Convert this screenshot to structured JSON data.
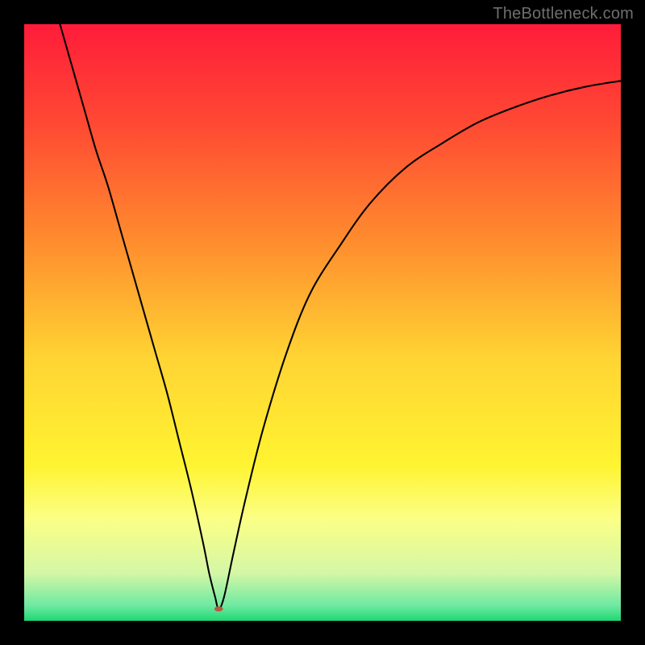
{
  "watermark": {
    "text": "TheBottleneck.com"
  },
  "chart_data": {
    "type": "line",
    "title": "",
    "xlabel": "",
    "ylabel": "",
    "xlim": [
      0,
      100
    ],
    "ylim": [
      0,
      100
    ],
    "grid": false,
    "legend": false,
    "background_gradient_stops": [
      {
        "pos": 0.0,
        "color": "#ff1c3a"
      },
      {
        "pos": 0.17,
        "color": "#ff4a33"
      },
      {
        "pos": 0.36,
        "color": "#ff8b2e"
      },
      {
        "pos": 0.56,
        "color": "#ffd433"
      },
      {
        "pos": 0.74,
        "color": "#fff432"
      },
      {
        "pos": 0.83,
        "color": "#fbff86"
      },
      {
        "pos": 0.92,
        "color": "#d4f7a6"
      },
      {
        "pos": 0.975,
        "color": "#6de9a1"
      },
      {
        "pos": 1.0,
        "color": "#1fd673"
      }
    ],
    "series": [
      {
        "name": "bottleneck-curve",
        "x": [
          6,
          8,
          10,
          12,
          14,
          16,
          18,
          20,
          22,
          24,
          26,
          28,
          30,
          31,
          32,
          32.6,
          33.5,
          35,
          37,
          40,
          44,
          48,
          53,
          58,
          64,
          70,
          76,
          82,
          88,
          94,
          100
        ],
        "y": [
          100,
          93,
          86,
          79,
          73,
          66,
          59,
          52,
          45,
          38,
          30,
          22,
          13,
          8,
          4,
          2,
          4,
          11,
          20,
          32,
          45,
          55,
          63,
          70,
          76,
          80,
          83.5,
          86,
          88,
          89.5,
          90.5
        ]
      }
    ],
    "marker": {
      "x": 32.6,
      "y": 2,
      "color": "#b6593f",
      "rx": 6,
      "ry": 3.6
    }
  }
}
